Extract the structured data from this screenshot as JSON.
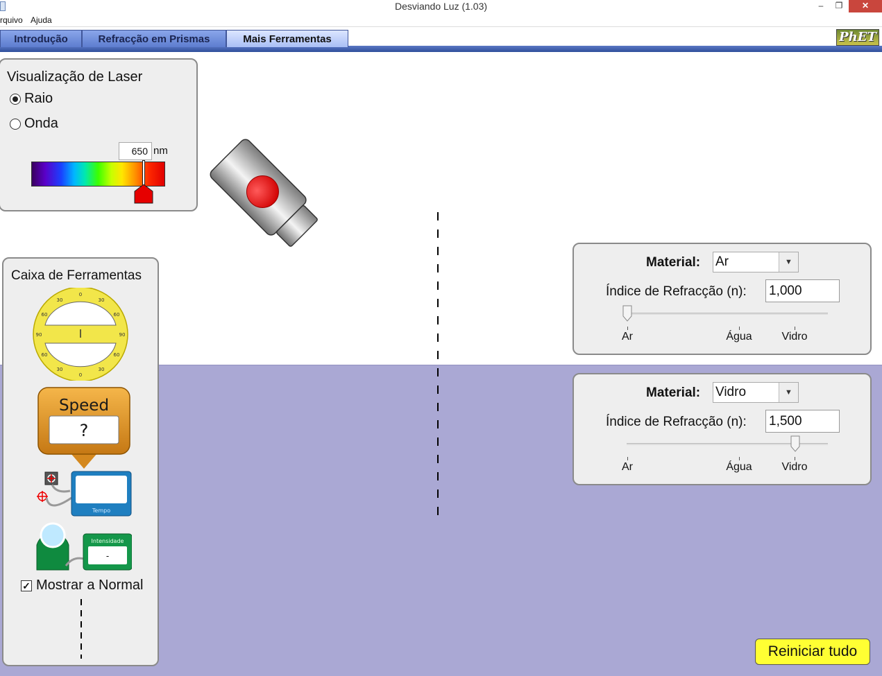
{
  "window": {
    "title": "Desviando Luz (1.03)",
    "minimize_glyph": "‒",
    "maximize_glyph": "❐",
    "close_glyph": "✕"
  },
  "menu": {
    "items": [
      "rquivo",
      "Ajuda"
    ]
  },
  "tabs": [
    {
      "label": "Introdução",
      "active": false
    },
    {
      "label": "Refracção em Prismas",
      "active": false
    },
    {
      "label": "Mais Ferramentas",
      "active": true
    }
  ],
  "logo": {
    "text": "PhET"
  },
  "laser_view": {
    "title": "Visualização de Laser",
    "options": [
      {
        "label": "Raio",
        "selected": true
      },
      {
        "label": "Onda",
        "selected": false
      }
    ],
    "wavelength_value": "650",
    "wavelength_unit": "nm"
  },
  "laser": {
    "color": "#ff0000"
  },
  "toolbox": {
    "title": "Caixa de Ferramentas",
    "protractor": {
      "ticks": [
        "0",
        "30",
        "60",
        "90",
        "60",
        "30",
        "0",
        "30",
        "60",
        "90",
        "60",
        "30"
      ]
    },
    "speed_tool": {
      "title": "Speed",
      "value": "?"
    },
    "time_tool": {
      "label": "Tempo"
    },
    "intensity_tool": {
      "label": "Intensidade",
      "value": "-"
    },
    "show_normal": {
      "label": "Mostrar a Normal",
      "checked": true
    }
  },
  "top_medium": {
    "material_label": "Material:",
    "material_value": "Ar",
    "index_label": "Índice de Refracção (n):",
    "index_value": "1,000",
    "slider_fraction": 0.0,
    "ticks": [
      "Ar",
      "Água",
      "Vidro"
    ],
    "color": "#ffffff"
  },
  "bottom_medium": {
    "material_label": "Material:",
    "material_value": "Vidro",
    "index_label": "Índice de Refracção (n):",
    "index_value": "1,500",
    "slider_fraction": 1.0,
    "ticks": [
      "Ar",
      "Água",
      "Vidro"
    ],
    "color": "#aaa8d4"
  },
  "reset_button": {
    "label": "Reiniciar tudo"
  }
}
